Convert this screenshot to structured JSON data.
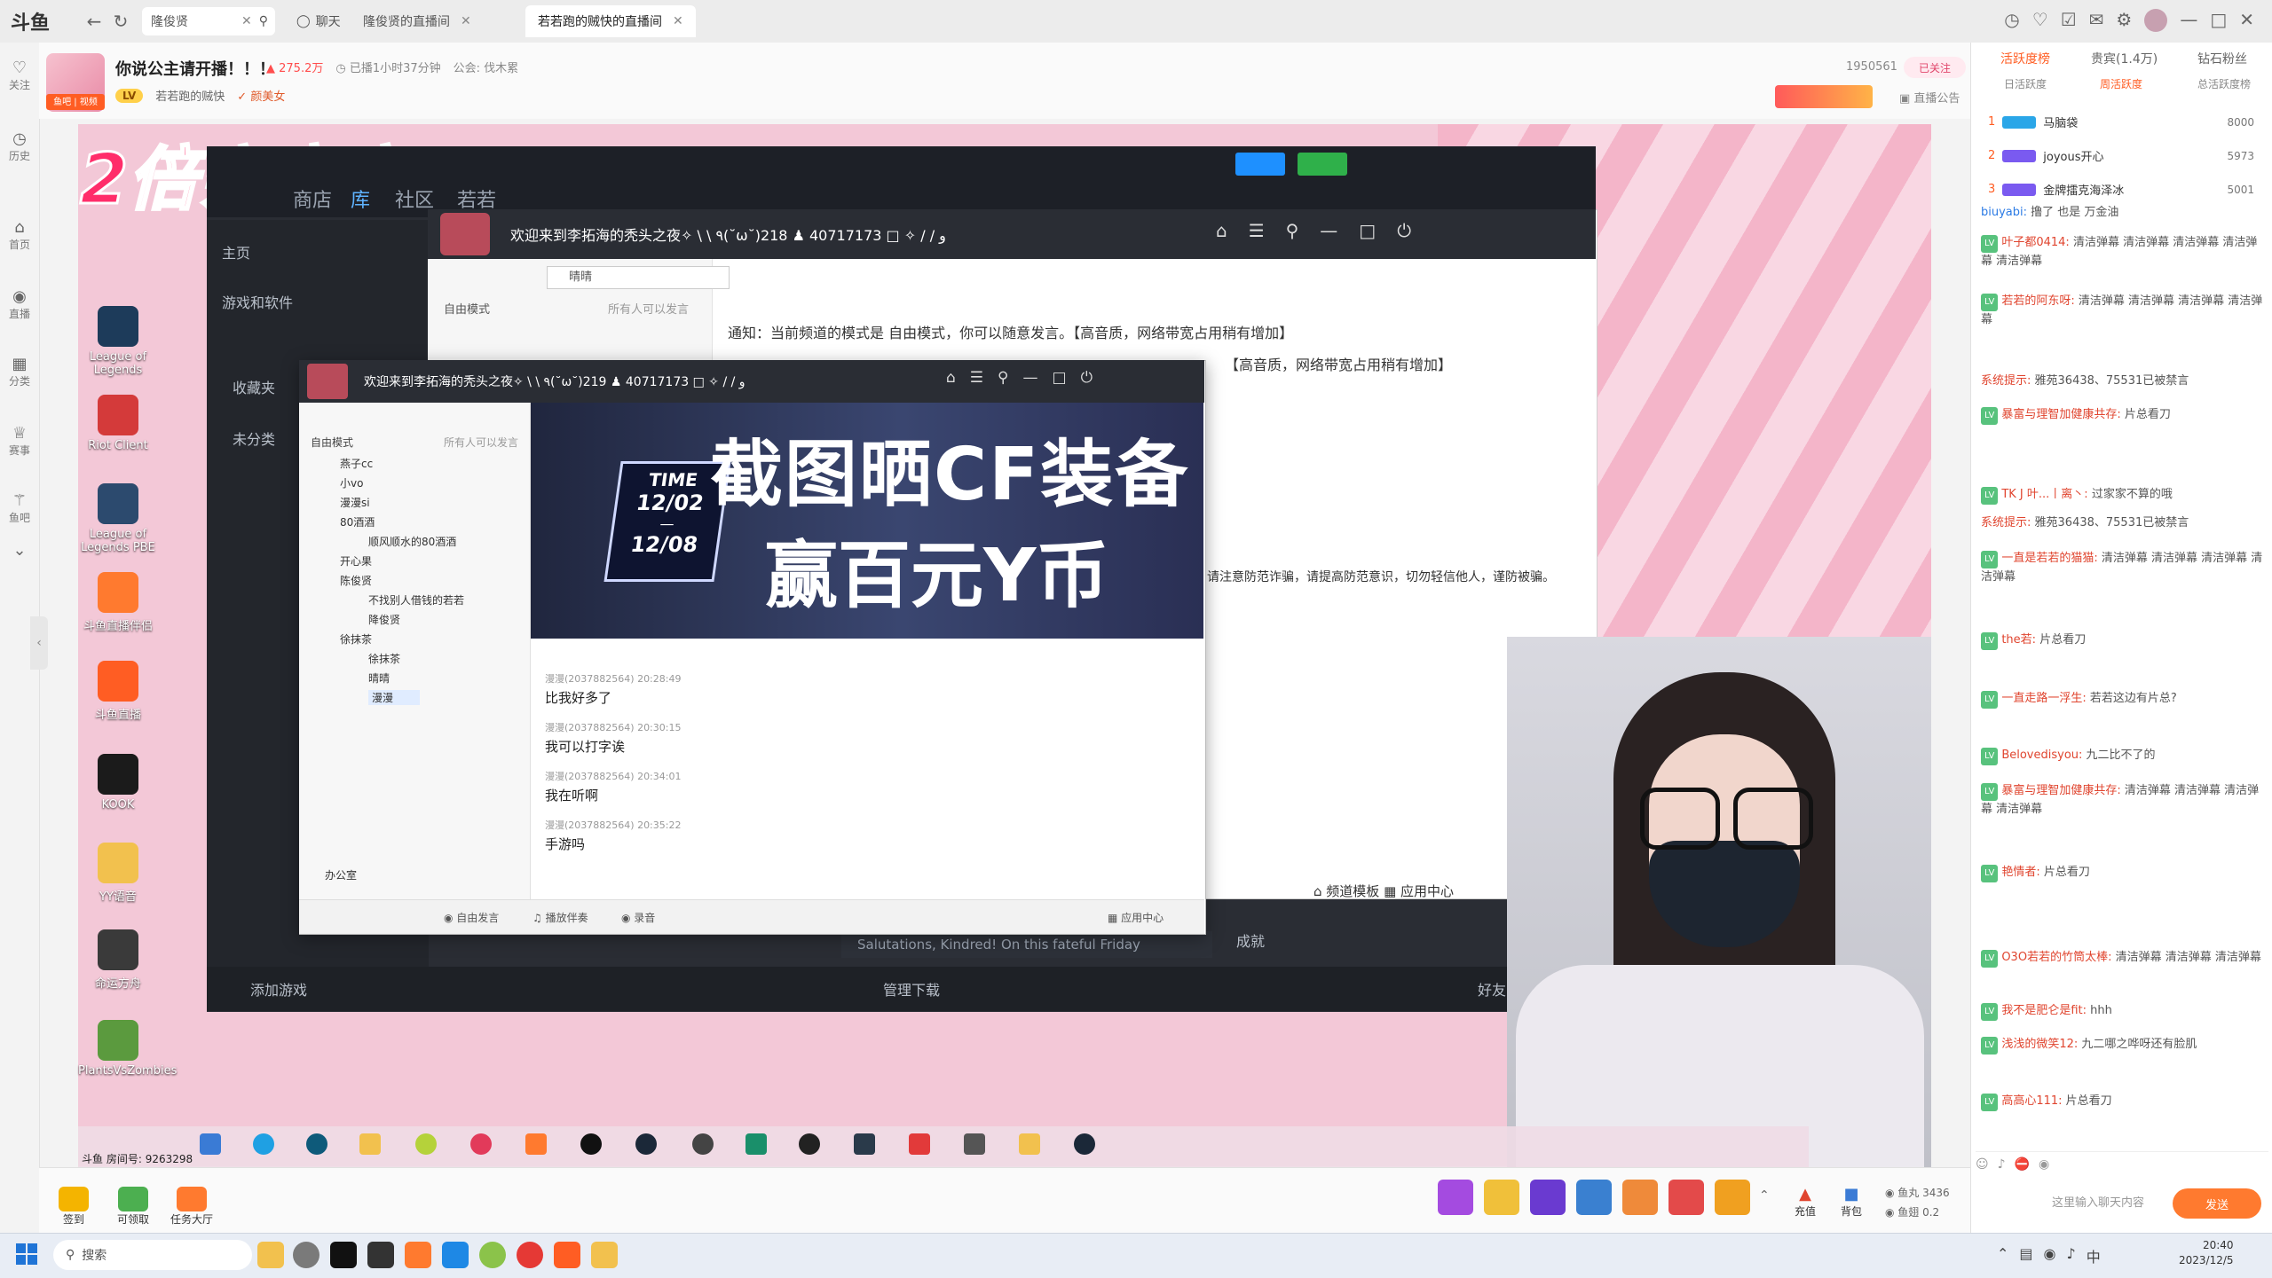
{
  "browser": {
    "logo": "斗鱼",
    "search_text": "隆俊贤",
    "tabs": [
      {
        "label": "聊天"
      },
      {
        "label": "隆俊贤的直播间"
      },
      {
        "label": "若若跑的贼快的直播间"
      }
    ]
  },
  "leftbar": {
    "items": [
      "关注",
      "历史",
      "首页",
      "直播",
      "分类",
      "赛事",
      "鱼吧"
    ]
  },
  "room": {
    "title": "你说公主请开播！！！",
    "hot": "275.2万",
    "live_time": "已播1小时37分钟",
    "guild": "公会: 伐木累",
    "level_badge": "若若跑的贼快",
    "tag": "颜美女",
    "room_id": "1950561",
    "follow_label": "已关注",
    "notice_label": "直播公告",
    "fanbadge": "鱼吧 | 视频"
  },
  "stream": {
    "promo_text": "2倍亲密度!",
    "desktop_icons": [
      "League of Legends",
      "Riot Client",
      "League of Legends PBE",
      "斗鱼直播伴侣",
      "斗鱼直播",
      "KOOK",
      "YY语音",
      "命运方舟",
      "PlantsVsZombies"
    ],
    "launcher": {
      "nav": [
        "商店",
        "库",
        "社区",
        "若若"
      ],
      "home": "主页",
      "section": "游戏和软件",
      "favorites": "收藏夹",
      "uncategorized": "未分类",
      "add_game": "添加游戏",
      "manage_download": "管理下载",
      "friends": "好友",
      "achievements": "成就",
      "ticker": "Salutations, Kindred! On this fateful Friday"
    },
    "chat_outer": {
      "title": "欢迎来到李拓海的秃头之夜✧ \\ \\ ٩(˘ω˘)و / / ✧",
      "id": "40717173",
      "members": "218",
      "mode": "自由模式",
      "mode_note": "所有人可以发言",
      "search_placeholder": "晴晴",
      "notice_1": "通知：当前频道的模式是 自由模式，你可以随意发言。【高音质，网络带宽占用稍有增加】",
      "notice_2": "【高音质，网络带宽占用稍有增加】",
      "notice_3": "请注意防范诈骗，请提高防范意识，切勿轻信他人，谨防被骗。",
      "template_label": "频道模板",
      "app_center": "应用中心"
    },
    "chat_inner": {
      "title": "欢迎来到李拓海的秃头之夜✧ \\ \\ ٩(˘ω˘)و / / ✧",
      "id": "40717173",
      "members": "219",
      "mode": "自由模式",
      "mode_note": "所有人可以发言",
      "channels": [
        "燕子cc",
        "小vo",
        "漫漫si",
        "80酒酒",
        "顺风顺水的80酒酒",
        "开心果",
        "陈俊贤",
        "不找别人借钱的若若",
        "降俊贤",
        "徐抹茶",
        "徐抹茶",
        "晴晴",
        "漫漫",
        "办公室"
      ],
      "banner_line1": "截图晒CF装备",
      "banner_line2": "赢百元Y币",
      "banner_time_label": "TIME",
      "banner_date_1": "12/02",
      "banner_date_2": "12/08",
      "messages": [
        {
          "meta": "漫漫(2037882564) 20:28:49",
          "text": "比我好多了"
        },
        {
          "meta": "漫漫(2037882564) 20:30:15",
          "text": "我可以打字诶"
        },
        {
          "meta": "漫漫(2037882564) 20:34:01",
          "text": "我在听啊"
        },
        {
          "meta": "漫漫(2037882564) 20:35:22",
          "text": "手游吗"
        }
      ],
      "footer": [
        "自由发言",
        "播放伴奏",
        "录音",
        "应用中心"
      ]
    }
  },
  "right_panel": {
    "tabs": [
      "活跃度榜",
      "贵宾(1.4万)",
      "钻石粉丝"
    ],
    "subtabs": [
      "日活跃度",
      "周活跃度",
      "总活跃度榜"
    ],
    "rank": [
      {
        "rank": "1",
        "name": "马脑袋",
        "score": "8000"
      },
      {
        "rank": "2",
        "name": "joyous开心",
        "score": "5973"
      },
      {
        "rank": "3",
        "name": "金牌擂克海泽冰",
        "score": "5001"
      }
    ],
    "chat": [
      {
        "user": "biuyabi:",
        "text": "撸了 也是 万金油"
      },
      {
        "user": "叶子都0414:",
        "text": "清洁弹幕 清洁弹幕 清洁弹幕 清洁弹幕 清洁弹幕"
      },
      {
        "user": "若若的阿东呀:",
        "text": "清洁弹幕 清洁弹幕 清洁弹幕 清洁弹幕"
      },
      {
        "user": "系统提示:",
        "text": "雅苑36438、75531已被禁言"
      },
      {
        "user": "暴富与理智加健康共存:",
        "text": "片总看刀"
      },
      {
        "user": "TK J 叶...丨离丶:",
        "text": "过家家不算的哦"
      },
      {
        "user": "系统提示:",
        "text": "雅苑36438、75531已被禁言"
      },
      {
        "user": "一直是若若的猫猫:",
        "text": "清洁弹幕 清洁弹幕 清洁弹幕 清洁弹幕"
      },
      {
        "user": "the若:",
        "text": "片总看刀"
      },
      {
        "user": "一直走路一浮生:",
        "text": "若若这边有片总?"
      },
      {
        "user": "Belovedisyou:",
        "text": "九二比不了的"
      },
      {
        "user": "暴富与理智加健康共存:",
        "text": "清洁弹幕 清洁弹幕 清洁弹幕 清洁弹幕"
      },
      {
        "user": "艳情者:",
        "text": "片总看刀"
      },
      {
        "user": "O3O若若的竹筒太棒:",
        "text": "清洁弹幕 清洁弹幕 清洁弹幕"
      },
      {
        "user": "我不是肥仑是fit:",
        "text": "hhh"
      },
      {
        "user": "浅浅的微笑12:",
        "text": "九二哪之哗呀还有脸肌"
      },
      {
        "user": "高高心111:",
        "text": "片总看刀"
      }
    ],
    "input_placeholder": "这里输入聊天内容",
    "send_label": "发送",
    "fish_balls": "3436",
    "fish_wing": "0.2",
    "recharge": "充值",
    "backpack": "背包"
  },
  "giftbar": {
    "items": [
      "签到",
      "可领取",
      "任务大厅"
    ]
  },
  "stream_taskbar": {
    "room_label": "斗鱼 房间号:",
    "room_no": "9263298"
  },
  "taskbar": {
    "search": "搜索",
    "time": "20:40",
    "date": "2023/12/5"
  }
}
